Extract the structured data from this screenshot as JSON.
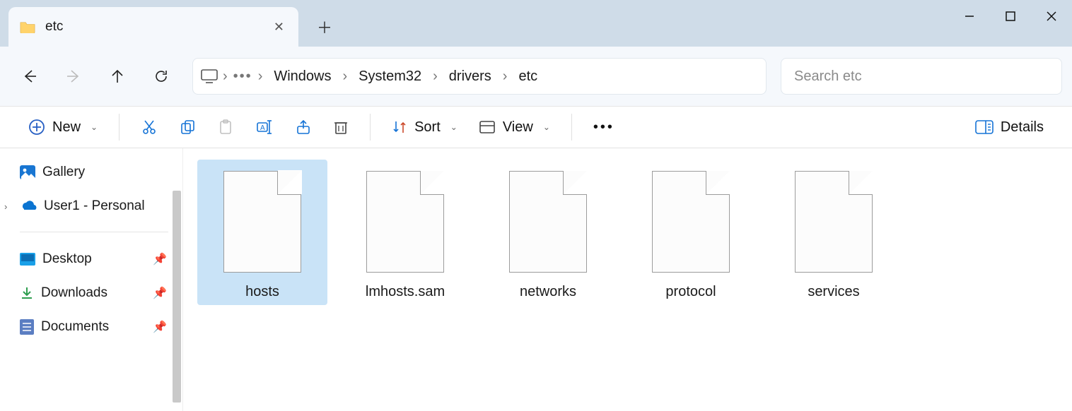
{
  "window": {
    "tab_title": "etc"
  },
  "breadcrumbs": [
    "Windows",
    "System32",
    "drivers",
    "etc"
  ],
  "search": {
    "placeholder": "Search etc"
  },
  "toolbar": {
    "new": "New",
    "sort": "Sort",
    "view": "View",
    "details": "Details"
  },
  "sidebar": {
    "gallery": "Gallery",
    "onedrive": "User1 - Personal",
    "desktop": "Desktop",
    "downloads": "Downloads",
    "documents": "Documents"
  },
  "files": [
    {
      "name": "hosts",
      "selected": true
    },
    {
      "name": "lmhosts.sam",
      "selected": false
    },
    {
      "name": "networks",
      "selected": false
    },
    {
      "name": "protocol",
      "selected": false
    },
    {
      "name": "services",
      "selected": false
    }
  ]
}
